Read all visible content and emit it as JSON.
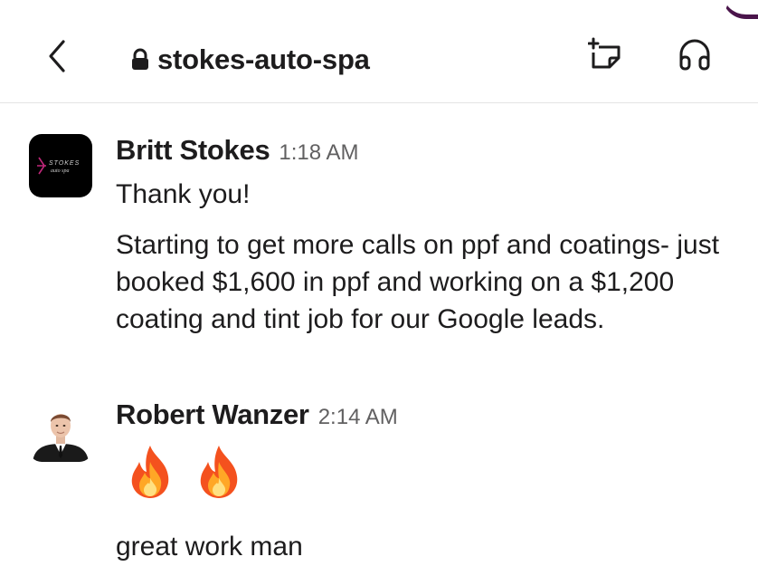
{
  "header": {
    "channel_name": "stokes-auto-spa",
    "icons": [
      "back-chevron-icon",
      "lock-icon",
      "canvas-icon",
      "headphones-icon"
    ]
  },
  "messages": [
    {
      "sender": "Britt Stokes",
      "time": "1:18 AM",
      "avatar_logo_text": "STOKES auto spa",
      "lines": [
        "Thank you!",
        "Starting to get more calls on ppf and coatings- just booked $1,600 in ppf and working on a $1,200 coating and tint job for our Google leads."
      ]
    },
    {
      "sender": "Robert Wanzer",
      "time": "2:14 AM",
      "emojis": [
        "fire-icon",
        "fire-icon"
      ],
      "lines": [
        "great work man"
      ]
    }
  ],
  "colors": {
    "text": "#1d1c1d",
    "timestamp": "#616061",
    "divider": "#e4e4e4",
    "accent": "#4a154b"
  }
}
